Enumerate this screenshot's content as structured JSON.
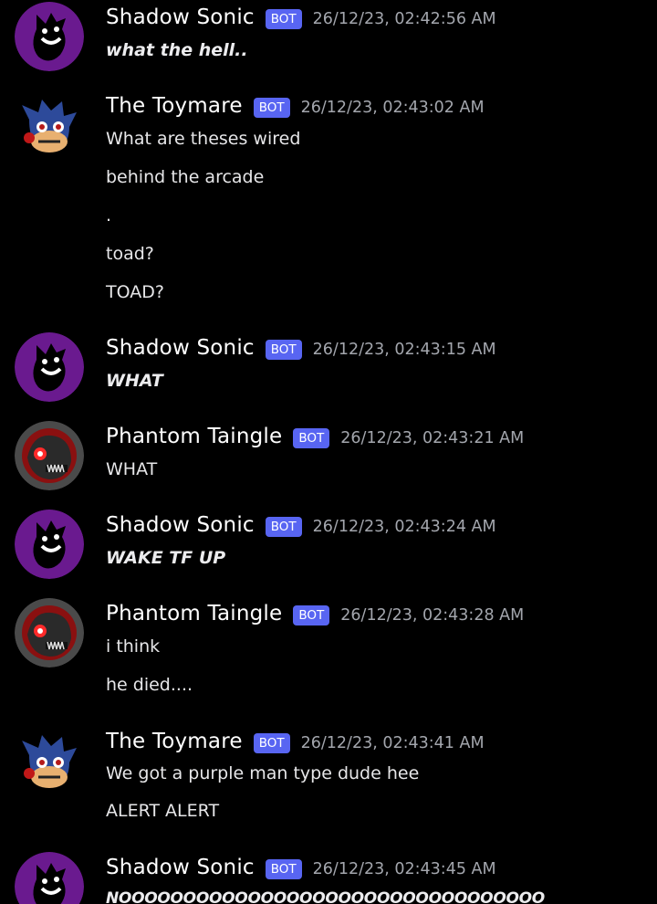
{
  "colors": {
    "background": "#000000",
    "bot_badge": "#5865f2",
    "timestamp": "#a3a6ad",
    "text": "#e6e6e8"
  },
  "messages": [
    {
      "author": "Shadow Sonic",
      "badge": "BOT",
      "timestamp": "26/12/23, 02:42:56 AM",
      "avatar_icon": "shadow-sonic-avatar-icon",
      "italic": true,
      "lines": [
        "what the hell.."
      ]
    },
    {
      "author": "The Toymare",
      "badge": "BOT",
      "timestamp": "26/12/23, 02:43:02 AM",
      "avatar_icon": "toymare-avatar-icon",
      "italic": false,
      "lines": [
        "What are theses wired",
        "behind the arcade",
        ".",
        "toad?",
        "TOAD?"
      ]
    },
    {
      "author": "Shadow Sonic",
      "badge": "BOT",
      "timestamp": "26/12/23, 02:43:15 AM",
      "avatar_icon": "shadow-sonic-avatar-icon",
      "italic": true,
      "lines": [
        "WHAT"
      ]
    },
    {
      "author": "Phantom Taingle",
      "badge": "BOT",
      "timestamp": "26/12/23, 02:43:21 AM",
      "avatar_icon": "phantom-taingle-avatar-icon",
      "italic": false,
      "lines": [
        "WHAT"
      ]
    },
    {
      "author": "Shadow Sonic",
      "badge": "BOT",
      "timestamp": "26/12/23, 02:43:24 AM",
      "avatar_icon": "shadow-sonic-avatar-icon",
      "italic": true,
      "lines": [
        "WAKE TF UP"
      ]
    },
    {
      "author": "Phantom Taingle",
      "badge": "BOT",
      "timestamp": "26/12/23, 02:43:28 AM",
      "avatar_icon": "phantom-taingle-avatar-icon",
      "italic": false,
      "lines": [
        "i think",
        "he died...."
      ]
    },
    {
      "author": "The Toymare",
      "badge": "BOT",
      "timestamp": "26/12/23, 02:43:41 AM",
      "avatar_icon": "toymare-avatar-icon",
      "italic": false,
      "lines": [
        "We got a purple man type dude hee",
        "ALERT ALERT"
      ]
    },
    {
      "author": "Shadow Sonic",
      "badge": "BOT",
      "timestamp": "26/12/23, 02:43:45 AM",
      "avatar_icon": "shadow-sonic-avatar-icon",
      "italic": true,
      "lines": [
        "NOOOOOOOOOOOOOOOOOOOOOOOOOOOOOOOOO"
      ]
    }
  ]
}
